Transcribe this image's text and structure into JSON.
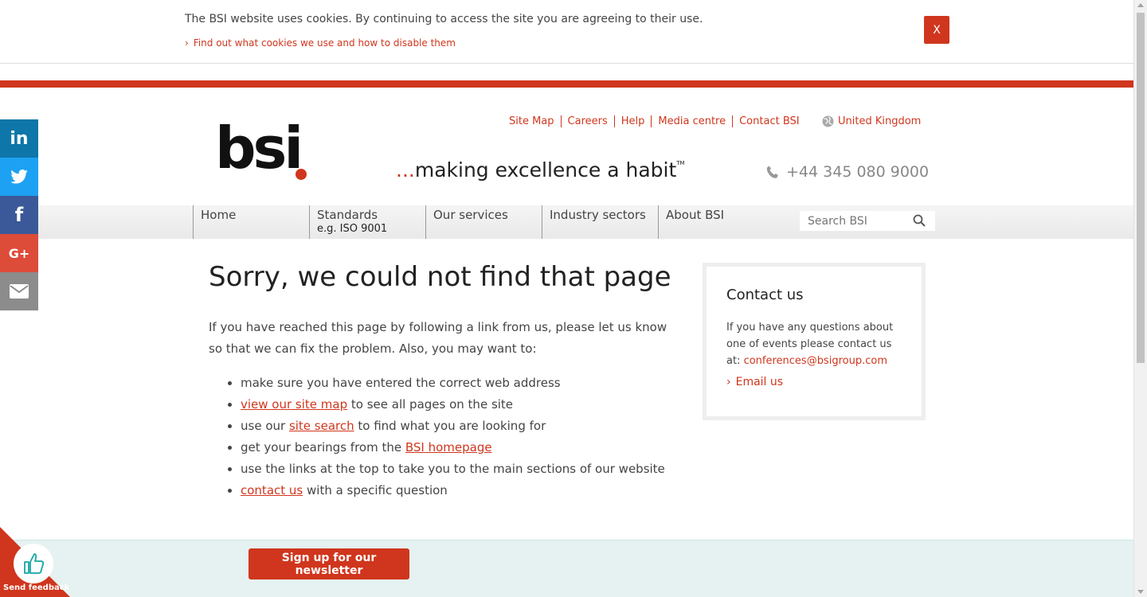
{
  "cookie_bar": {
    "message": "The BSI website uses cookies. By continuing to access the site you are agreeing to their use.",
    "link_text": "Find out what cookies we use and how to disable them",
    "close_label": "X"
  },
  "social": {
    "linkedin": "in",
    "facebook": "f",
    "googleplus": "G+"
  },
  "header": {
    "logo_text": "bsi",
    "tagline_dots": "...",
    "tagline": "making excellence a habit",
    "tagline_tm": "TM",
    "top_links": [
      "Site Map",
      "Careers",
      "Help",
      "Media centre",
      "Contact BSI"
    ],
    "country": "United Kingdom",
    "phone": "+44 345 080 9000"
  },
  "nav": {
    "items": [
      {
        "label": "Home",
        "sub": ""
      },
      {
        "label": "Standards",
        "sub": "e.g. ISO 9001"
      },
      {
        "label": "Our services",
        "sub": ""
      },
      {
        "label": "Industry sectors",
        "sub": ""
      },
      {
        "label": "About BSI",
        "sub": ""
      }
    ],
    "search_placeholder": "Search BSI"
  },
  "main": {
    "title": "Sorry, we could not find that page",
    "intro": "If you have reached this page by following a link from us, please let us know so that we can fix the problem. Also, you may want to:",
    "bullets": [
      {
        "pre": "make sure you have entered the correct web address",
        "link": "",
        "post": ""
      },
      {
        "pre": "",
        "link": "view our site map",
        "post": " to see all pages on the site"
      },
      {
        "pre": "use our ",
        "link": "site search",
        "post": " to find what you are looking for"
      },
      {
        "pre": "get your bearings from the ",
        "link": "BSI homepage",
        "post": ""
      },
      {
        "pre": "use the links at the top to take you to the main sections of our website",
        "link": "",
        "post": ""
      },
      {
        "pre": "",
        "link": "contact us",
        "post": " with a specific question"
      }
    ]
  },
  "contact": {
    "title": "Contact us",
    "text": "If you have any questions about one of events please contact us at: ",
    "email": "conferences@bsigroup.com",
    "email_us": "Email us"
  },
  "footer": {
    "newsletter_button": "Sign up for our newsletter"
  },
  "feedback": {
    "label": "Send feedback"
  },
  "colors": {
    "brand_red": "#d0361d",
    "linkedin": "#0e76a8",
    "twitter": "#1da1f2",
    "facebook": "#3b5998",
    "googleplus": "#dd4b39",
    "email": "#8c8c8c",
    "footer_bg": "#e5f2f1"
  }
}
